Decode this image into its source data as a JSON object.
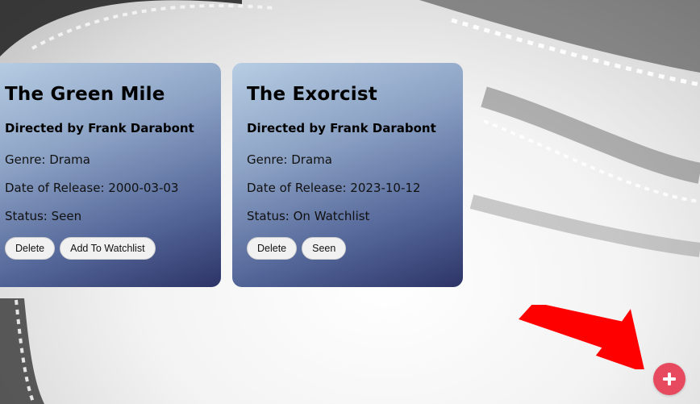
{
  "movies": [
    {
      "title": "The Green Mile",
      "director": "Directed by Frank Darabont",
      "genre": "Genre: Drama",
      "release": "Date of Release: 2000-03-03",
      "status": "Status: Seen",
      "buttons": [
        "Delete",
        "Add To Watchlist"
      ]
    },
    {
      "title": "The Exorcist",
      "director": "Directed by Frank Darabont",
      "genre": "Genre: Drama",
      "release": "Date of Release: 2023-10-12",
      "status": "Status: On Watchlist",
      "buttons": [
        "Delete",
        "Seen"
      ]
    }
  ],
  "fab": {
    "icon": "plus-icon",
    "color": "#e7495f"
  },
  "annotation": {
    "icon": "red-arrow",
    "color": "#ff0000"
  }
}
